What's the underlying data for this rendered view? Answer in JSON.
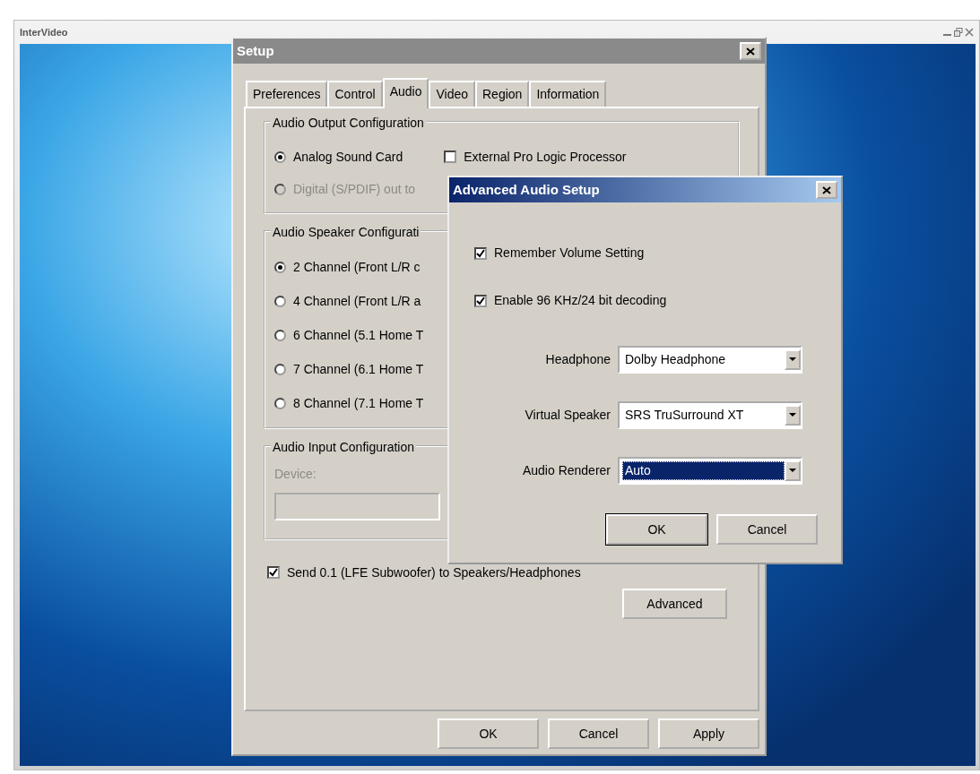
{
  "player": {
    "logo": "InterVideo"
  },
  "setup": {
    "title": "Setup",
    "tabs": [
      {
        "label": "Preferences",
        "selected": false
      },
      {
        "label": "Control",
        "selected": false
      },
      {
        "label": "Audio",
        "selected": true
      },
      {
        "label": "Video",
        "selected": false
      },
      {
        "label": "Region",
        "selected": false
      },
      {
        "label": "Information",
        "selected": false
      }
    ],
    "output_group": {
      "title": "Audio Output Configuration",
      "options": [
        {
          "label": "Analog Sound Card",
          "selected": true,
          "disabled": false
        },
        {
          "label": "Digital (S/PDIF) out to",
          "selected": false,
          "disabled": true
        }
      ],
      "external_checkbox": {
        "label": "External Pro Logic Processor",
        "checked": false
      }
    },
    "speaker_group": {
      "title": "Audio Speaker Configurati",
      "options": [
        {
          "label": "2 Channel (Front L/R c",
          "selected": true
        },
        {
          "label": "4 Channel (Front L/R a",
          "selected": false
        },
        {
          "label": "6 Channel (5.1 Home T",
          "selected": false
        },
        {
          "label": "7 Channel (6.1 Home T",
          "selected": false
        },
        {
          "label": "8 Channel (7.1 Home T",
          "selected": false
        }
      ]
    },
    "input_group": {
      "title": "Audio Input Configuration",
      "device_label": "Device:",
      "disabled": true
    },
    "lfe_checkbox": {
      "label": "Send 0.1 (LFE Subwoofer) to Speakers/Headphones",
      "checked": true
    },
    "advanced_button": "Advanced",
    "buttons": [
      "OK",
      "Cancel",
      "Apply"
    ]
  },
  "advanced": {
    "title": "Advanced Audio Setup",
    "checkboxes": [
      {
        "label": "Remember Volume Setting",
        "checked": true
      },
      {
        "label": "Enable 96 KHz/24 bit decoding",
        "checked": true
      }
    ],
    "selects": [
      {
        "label": "Headphone",
        "value": "Dolby Headphone",
        "focused": false
      },
      {
        "label": "Virtual Speaker",
        "value": "SRS TruSurround XT",
        "focused": false
      },
      {
        "label": "Audio Renderer",
        "value": "Auto",
        "focused": true
      }
    ],
    "buttons": [
      {
        "label": "OK",
        "default": true
      },
      {
        "label": "Cancel",
        "default": false
      }
    ]
  }
}
